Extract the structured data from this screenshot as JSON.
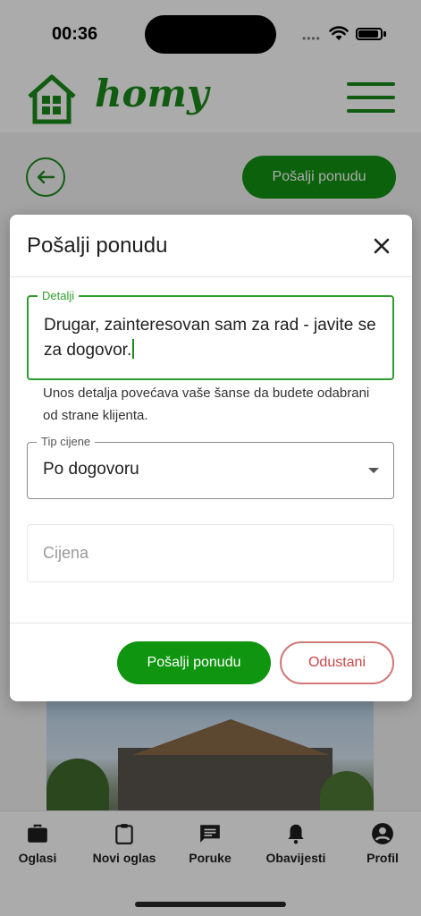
{
  "status_bar": {
    "time": "00:36",
    "signal": "••••"
  },
  "header": {
    "logo_text": "homy",
    "brand_color": "#1a8a1a"
  },
  "page": {
    "send_offer_label": "Pošalji ponudu"
  },
  "modal": {
    "title": "Pošalji ponudu",
    "details": {
      "label": "Detalji",
      "value": "Drugar, zainteresovan sam za rad - javite se za dogovor."
    },
    "helper_text": "Unos detalja povećava vaše šanse da budete odabrani od strane klijenta.",
    "price_type": {
      "label": "Tip cijene",
      "selected": "Po dogovoru"
    },
    "price": {
      "placeholder": "Cijena"
    },
    "submit_label": "Pošalji ponudu",
    "cancel_label": "Odustani",
    "colors": {
      "accent": "#0f950f",
      "cancel": "#c64545"
    }
  },
  "bottom_nav": {
    "items": [
      {
        "label": "Oglasi",
        "icon": "briefcase-icon"
      },
      {
        "label": "Novi oglas",
        "icon": "clipboard-icon"
      },
      {
        "label": "Poruke",
        "icon": "chat-icon"
      },
      {
        "label": "Obavijesti",
        "icon": "bell-icon"
      },
      {
        "label": "Profil",
        "icon": "account-circle-icon"
      }
    ]
  }
}
